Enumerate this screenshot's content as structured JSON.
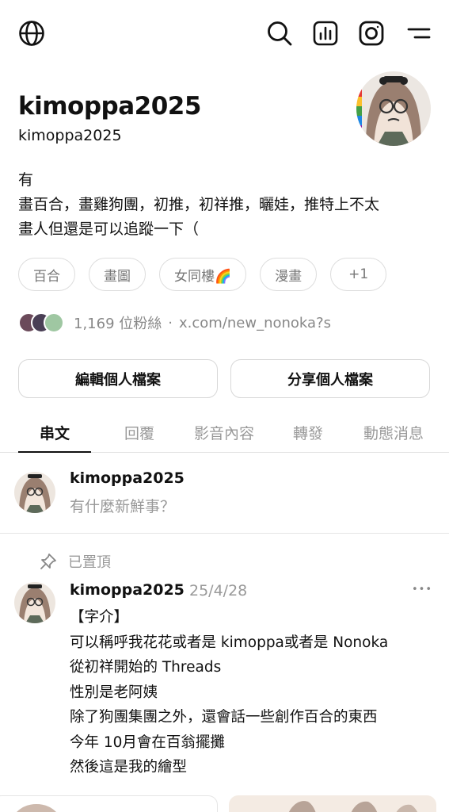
{
  "profile": {
    "name": "kimoppa2025",
    "handle": "kimoppa2025",
    "bio": [
      "有",
      "畫百合，畫雞狗團，初推，初祥推，曬娃，推特上不太",
      "畫人但還是可以追蹤一下（"
    ],
    "tags": [
      {
        "label": "百合"
      },
      {
        "label": "畫圖"
      },
      {
        "label": "女同樓🌈"
      },
      {
        "label": "漫畫"
      },
      {
        "label": "+1"
      }
    ],
    "followers_text": "1,169 位粉絲",
    "separator": "·",
    "link": "x.com/new_nonoka?s"
  },
  "actions": {
    "edit_label": "編輯個人檔案",
    "share_label": "分享個人檔案"
  },
  "tabs": [
    {
      "label": "串文",
      "active": true
    },
    {
      "label": "回覆",
      "active": false
    },
    {
      "label": "影音內容",
      "active": false
    },
    {
      "label": "轉發",
      "active": false
    },
    {
      "label": "動態消息",
      "active": false
    }
  ],
  "compose": {
    "username": "kimoppa2025",
    "placeholder": "有什麼新鮮事？"
  },
  "post": {
    "pinned_label": "已置頂",
    "username": "kimoppa2025",
    "date": "25/4/28",
    "more": "•••",
    "lines": [
      "【字介】",
      "可以稱呼我花花或者是 kimoppa或者是 Nonoka",
      "從初祥開始的 Threads",
      "性別是老阿姨",
      "除了狗團集團之外，還會話一些創作百合的東西",
      "今年 10月會在百翁擺攤",
      "然後這是我的繪型"
    ]
  },
  "icons": {
    "globe": "globe-icon",
    "search": "search-icon",
    "insights": "insights-icon",
    "instagram": "instagram-icon",
    "menu": "menu-icon",
    "pin": "pin-icon"
  }
}
